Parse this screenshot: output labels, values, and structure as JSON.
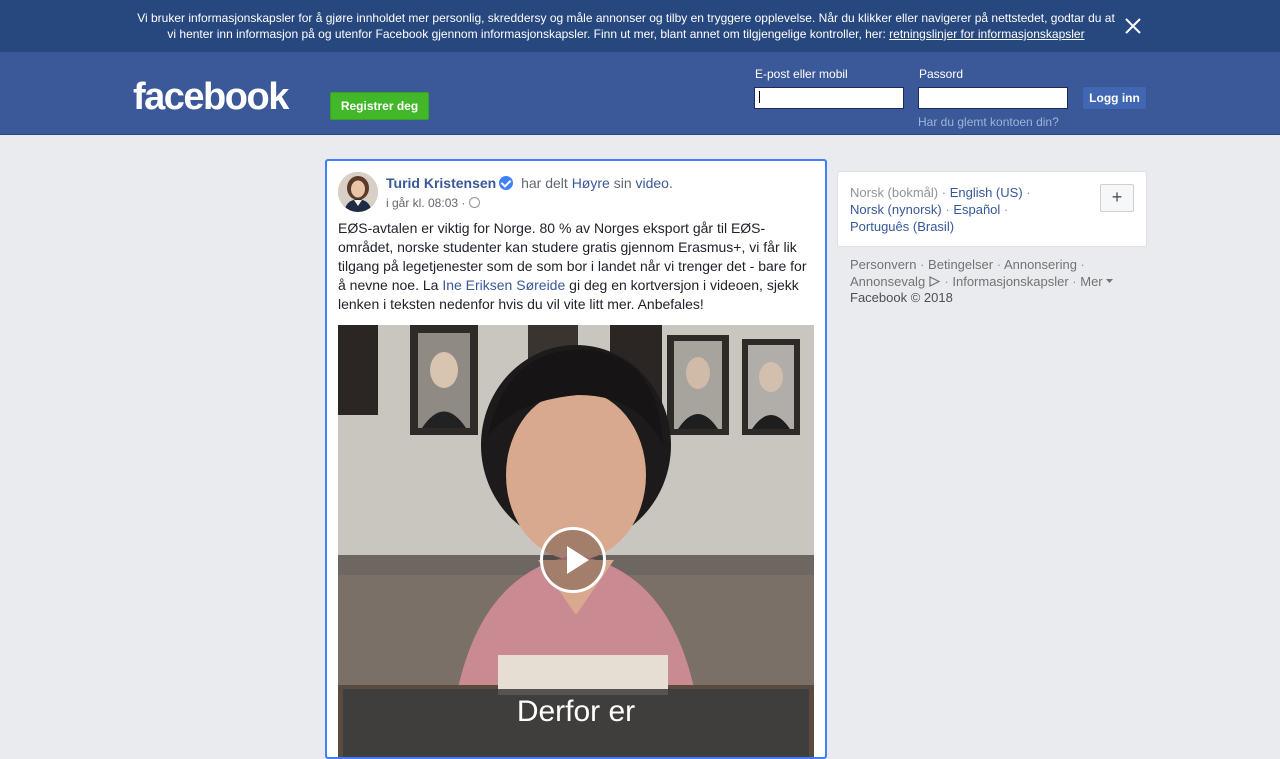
{
  "cookie_banner": {
    "text_line1": "Vi bruker informasjonskapsler for å gjøre innholdet mer personlig, skreddersy og måle annonser og tilby en tryggere opplevelse. Når du klikker eller navigerer på nettstedet, godtar du at",
    "text_line2": "vi henter inn informasjon på og utenfor Facebook gjennom informasjonskapsler. Finn ut mer, blant annet om tilgjengelige kontroller, her:",
    "link": "retningslinjer for informasjonskapsler",
    "close_icon": "close-icon"
  },
  "header": {
    "logo": "facebook",
    "register_label": "Registrer deg",
    "email_label": "E-post eller mobil",
    "email_value": "",
    "password_label": "Passord",
    "password_value": "",
    "login_label": "Logg inn",
    "forgot_label": "Har du glemt kontoen din?"
  },
  "post": {
    "author": "Turid Kristensen",
    "shared_text": "har delt",
    "page_name": "Høyre",
    "sin": "sin",
    "video_link": "video",
    "timestamp": "i går kl. 08:03 ·",
    "text_part1": "EØS-avtalen er viktig for Norge. 80 % av Norges eksport går til EØS-området, norske studenter kan studere gratis gjennom Erasmus+, vi får lik tilgang på legetjenester som de som bor i landet når vi trenger det - bare for å nevne noe. La",
    "mention": "Ine Eriksen Søreide",
    "text_part2": "gi deg en kortversjon i videoen, sjekk lenken i teksten nedenfor hvis du vil vite litt mer. Anbefales!",
    "video_caption": "Derfor er"
  },
  "languages": {
    "current": "Norsk (bokmål)",
    "items": [
      "English (US)",
      "Norsk (nynorsk)",
      "Español",
      "Português (Brasil)"
    ],
    "add_label": "+"
  },
  "footer": {
    "links": [
      "Personvern",
      "Betingelser",
      "Annonsering",
      "Annonsevalg",
      "Informasjonskapsler",
      "Mer"
    ],
    "copyright": "Facebook © 2018"
  },
  "colors": {
    "banner": "#27477f",
    "header": "#3b5998",
    "register": "#42b72a",
    "link": "#385898",
    "focus_border": "#4080ff"
  }
}
